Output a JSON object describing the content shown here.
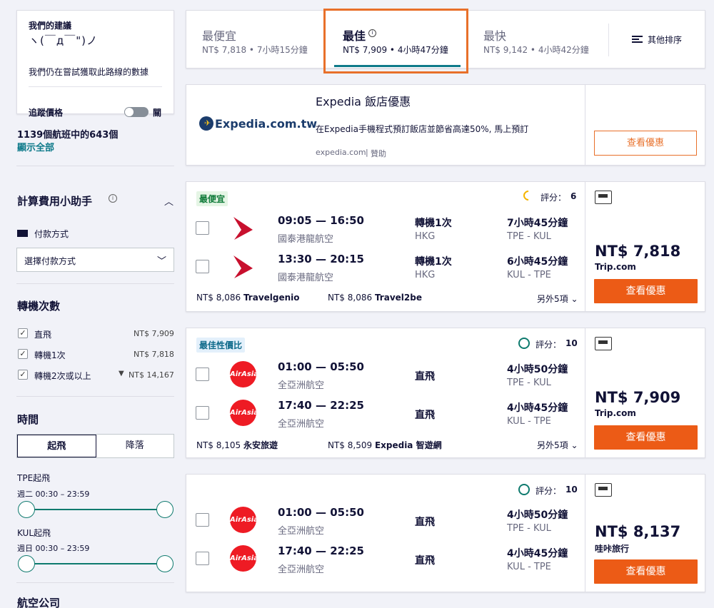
{
  "recommendation": {
    "title": "我們的建議",
    "face": "ヽ(￣д￣\")ノ",
    "message": "我們仍在嘗試獲取此路線的數據",
    "track_label": "追蹤價格",
    "track_state": "關"
  },
  "flights_count": "1139個航班中的643個",
  "show_all": "顯示全部",
  "cost_helper": {
    "title": "計算費用小助手",
    "payment_label": "付款方式",
    "payment_placeholder": "選擇付款方式"
  },
  "stops_filter": {
    "title": "轉機次數",
    "options": [
      {
        "label": "直飛",
        "price": "NT$ 7,909",
        "checked": true
      },
      {
        "label": "轉機1次",
        "price": "NT$ 7,818",
        "checked": true
      },
      {
        "label": "轉機2次或以上",
        "price": "NT$ 14,167",
        "checked": true
      }
    ]
  },
  "time_filter": {
    "title": "時間",
    "tabs": [
      "起飛",
      "降落"
    ],
    "tpe_label": "TPE起飛",
    "tpe_range": "週二 00:30 – 23:59",
    "kul_label": "KUL起飛",
    "kul_range": "週日 00:30 – 23:59"
  },
  "airlines_title": "航空公司",
  "sort_tabs": [
    {
      "name": "最便宜",
      "summary": "NT$ 7,818 • 7小時15分鐘",
      "active": false
    },
    {
      "name": "最佳",
      "summary": "NT$ 7,909 • 4小時47分鐘",
      "active": true
    },
    {
      "name": "最快",
      "summary": "NT$ 9,142 • 4小時42分鐘",
      "active": false
    }
  ],
  "sort_other": "其他排序",
  "ad": {
    "logo": "Expedia.com.tw",
    "title": "Expedia 飯店優惠",
    "text": "在Expedia手機程式預訂飯店並節省高達50%, 馬上預訂",
    "source": "expedia.com",
    "sponsor": "贊助",
    "button": "查看優惠"
  },
  "results": [
    {
      "badge": "最便宜",
      "badge_color": "#e5f5e5",
      "score_label": "評分：",
      "score": "6",
      "legs": [
        {
          "time": "09:05 — 16:50",
          "carrier": "國泰港龍航空",
          "stops": "轉機1次",
          "via": "HKG",
          "duration": "7小時45分鐘",
          "route": "TPE - KUL"
        },
        {
          "time": "13:30 — 20:15",
          "carrier": "國泰港龍航空",
          "stops": "轉機1次",
          "via": "HKG",
          "duration": "6小時45分鐘",
          "route": "KUL - TPE"
        }
      ],
      "alt1_price": "NT$ 8,086",
      "alt1_agent": "Travelgenio",
      "alt2_price": "NT$ 8,086",
      "alt2_agent": "Travel2be",
      "more": "另外5項",
      "price": "NT$ 7,818",
      "agent": "Trip.com",
      "button": "查看優惠"
    },
    {
      "badge": "最佳性價比",
      "badge_color": "#e3f0fb",
      "score_label": "評分：",
      "score": "10",
      "legs": [
        {
          "time": "01:00 — 05:50",
          "carrier": "全亞洲航空",
          "stops": "直飛",
          "via": "",
          "duration": "4小時50分鐘",
          "route": "TPE - KUL"
        },
        {
          "time": "17:40 — 22:25",
          "carrier": "全亞洲航空",
          "stops": "直飛",
          "via": "",
          "duration": "4小時45分鐘",
          "route": "KUL - TPE"
        }
      ],
      "alt1_price": "NT$ 8,105",
      "alt1_agent": "永安旅遊",
      "alt2_price": "NT$ 8,509",
      "alt2_agent": "Expedia 智遊網",
      "more": "另外5項",
      "price": "NT$ 7,909",
      "agent": "Trip.com",
      "button": "查看優惠"
    },
    {
      "score_label": "評分：",
      "score": "10",
      "legs": [
        {
          "time": "01:00 — 05:50",
          "carrier": "全亞洲航空",
          "stops": "直飛",
          "via": "",
          "duration": "4小時50分鐘",
          "route": "TPE - KUL"
        },
        {
          "time": "17:40 — 22:25",
          "carrier": "全亞洲航空",
          "stops": "直飛",
          "via": "",
          "duration": "4小時45分鐘",
          "route": "KUL - TPE"
        }
      ],
      "price": "NT$ 8,137",
      "agent": "哇咔旅行",
      "button": "查看優惠"
    }
  ],
  "airasia_logo": "AirAsia",
  "colors": {
    "accent": "#ec5b16",
    "teal": "#0e7a6e",
    "highlight": "#e8702a"
  }
}
